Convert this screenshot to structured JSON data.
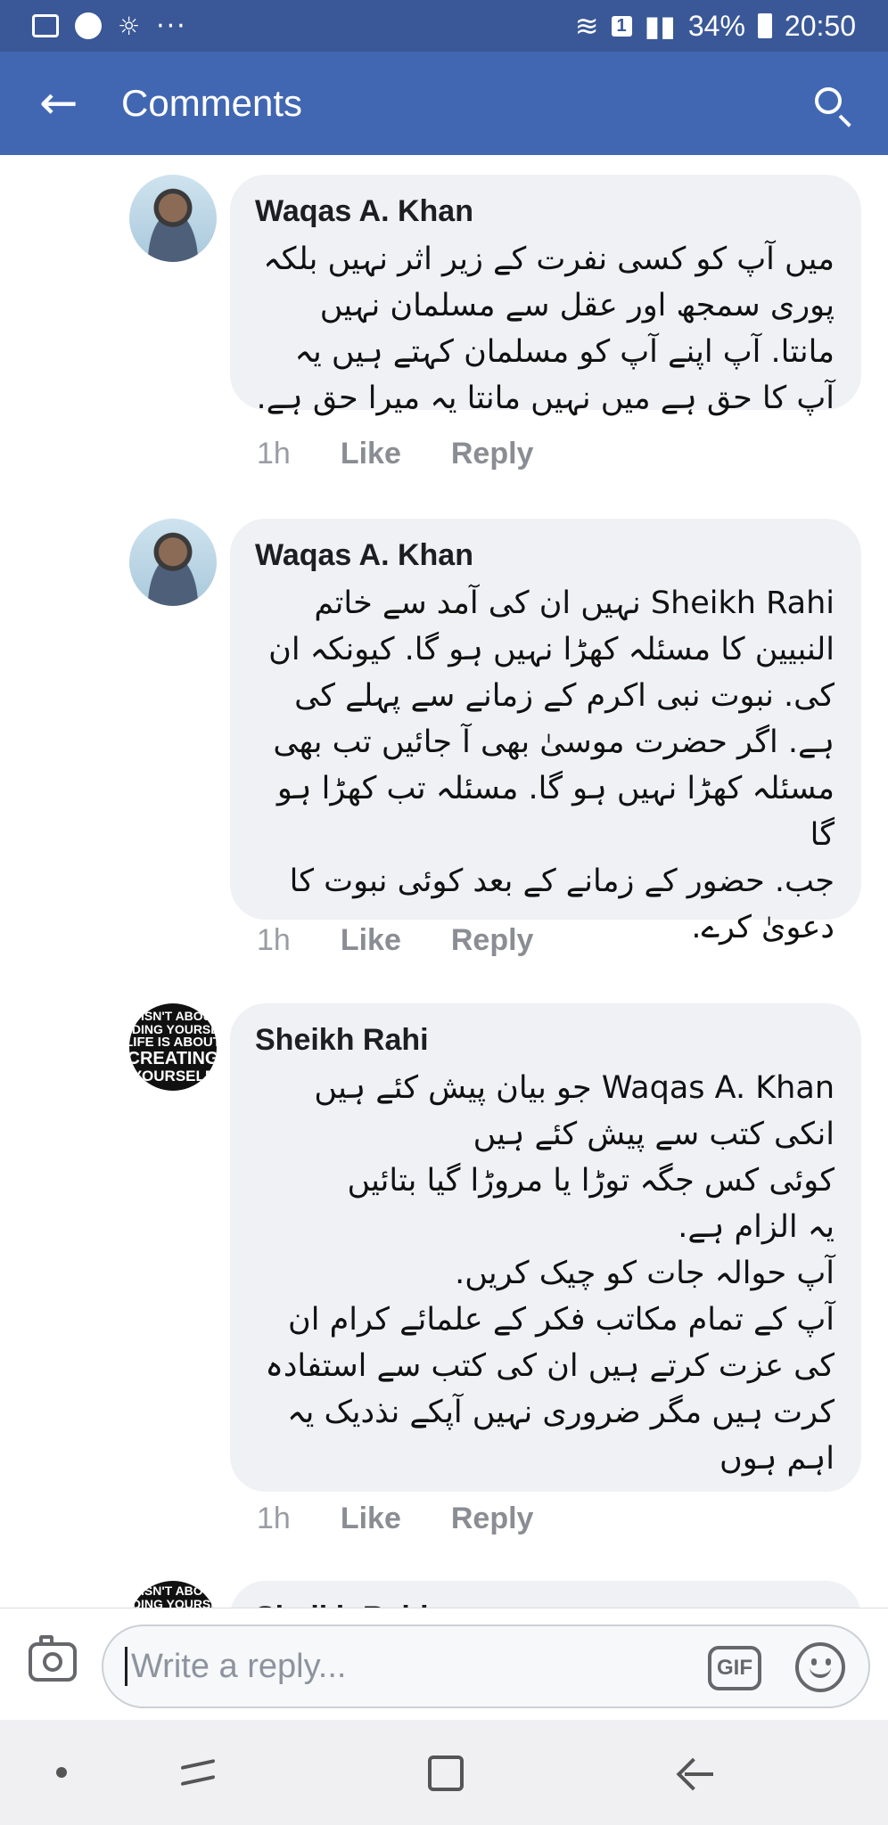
{
  "status_bar": {
    "battery_percent": "34%",
    "time": "20:50",
    "sim_slot": "1"
  },
  "app_bar": {
    "title": "Comments"
  },
  "comments": [
    {
      "author": "Waqas A. Khan",
      "avatar": "person-photo",
      "lines": [
        "میں آپ کو کسی نفرت کے زیر اثر نہیں بلکہ",
        "پوری سمجھ اور عقل سے مسلمان نہیں",
        "مانتا. آپ اپنے آپ کو مسلمان کہتے ہیں یہ",
        "آپ کا حق ہے میں نہیں مانتا یہ میرا حق ہے."
      ],
      "time": "1h",
      "like": "Like",
      "reply": "Reply"
    },
    {
      "author": "Waqas A. Khan",
      "avatar": "person-photo",
      "lines": [
        "Sheikh Rahi نہیں ان کی آمد سے خاتم",
        "النبیین کا مسئلہ کھڑا نہیں ہو گا. کیونکہ ان",
        "کی. نبوت نبی اکرم کے زمانے سے پہلے کی",
        "ہے. اگر حضرت موسیٰ بھی آ جائیں تب بھی",
        "مسئلہ کھڑا نہیں ہو گا. مسئلہ تب کھڑا ہو گا",
        "جب. حضور کے زمانے کے بعد کوئی نبوت کا",
        "دعویٰ کرے."
      ],
      "time": "1h",
      "like": "Like",
      "reply": "Reply"
    },
    {
      "author": "Sheikh Rahi",
      "avatar": "quote-image",
      "avatar_text": [
        "IT ISN'T ABOUT",
        "FINDING YOURSELF",
        "LIFE IS ABOUT",
        "CREATING",
        "YOURSELF"
      ],
      "lines": [
        "Waqas A. Khan جو بیان پیش کئے ہیں",
        "انکی کتب سے پیش کئے ہیں",
        "کوئی کس جگہ توڑا یا مروڑا گیا بتائیں",
        "یہ الزام ہے.",
        "آپ حوالہ جات کو چیک کریں.",
        "آپ کے تمام مکاتب فکر کے علمائے کرام ان",
        "کی عزت کرتے ہیں ان کی کتب سے استفادہ",
        "کرت ہیں مگر ضروری نہیں آپکے نذدیک یہ",
        "اہم ہوں"
      ],
      "time": "1h",
      "like": "Like",
      "reply": "Reply"
    },
    {
      "author": "Sheikh Rahi",
      "avatar": "quote-image",
      "avatar_text": [
        "IT ISN'T ABOUT",
        "FINDING YOURSELF"
      ]
    }
  ],
  "composer": {
    "placeholder": "Write a reply...",
    "gif_label": "GIF"
  },
  "icons": {
    "back": "arrow-left-icon",
    "search": "search-icon",
    "camera": "camera-icon",
    "emoji": "smiley-icon"
  },
  "colors": {
    "status_bar": "#3a5897",
    "app_bar": "#4267b2",
    "bubble": "#f0f1f5"
  }
}
